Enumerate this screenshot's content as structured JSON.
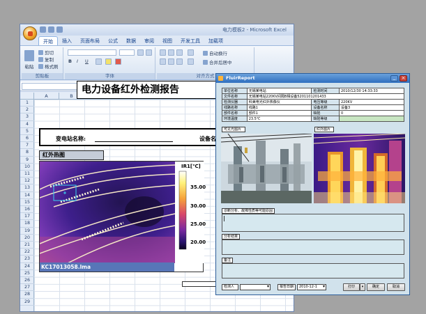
{
  "excel": {
    "window_title": "电力模板2 - Microsoft Excel",
    "tabs": [
      "开始",
      "插入",
      "页面布局",
      "公式",
      "数据",
      "审阅",
      "视图",
      "开发工具",
      "加载项"
    ],
    "ribbon": {
      "cut": "剪切",
      "copy": "复制",
      "format_painter": "格式刷",
      "paste": "粘贴",
      "clipboard_group": "剪贴板",
      "font_group": "字体",
      "align_group": "对齐方式",
      "wrap_text": "自动换行",
      "merge_center": "合并后居中",
      "bold": "B",
      "italic": "I",
      "underline": "U"
    },
    "fx": "fx",
    "columns": [
      "A",
      "B",
      "C",
      "D",
      "E",
      "F",
      "G"
    ],
    "rows": [
      "1",
      "2",
      "3",
      "4",
      "5",
      "6",
      "7",
      "8",
      "9",
      "10",
      "11",
      "12",
      "13",
      "14",
      "15",
      "16",
      "17",
      "18",
      "19",
      "20",
      "21",
      "22",
      "23",
      "24",
      "25",
      "26",
      "27",
      "28",
      "29"
    ],
    "report_title": "电力设备红外检测报告",
    "station_label": "变电站名称:",
    "device_label": "设备名称:",
    "ir_image_label": "红外热图",
    "scale_title": "IR1[℃]",
    "scale_ticks": [
      "35.00",
      "30.00",
      "25.00",
      "20.00"
    ],
    "ir_filename": "KC17013058.lma"
  },
  "dialog": {
    "title": "FluirReport",
    "info_rows": [
      [
        "单位名称",
        "无锡某电站",
        "检测时间",
        "2010/12/30 14:33:33"
      ],
      [
        "文件名称",
        "无锡某电站220KV间隔B相设备5201101201433",
        "",
        ""
      ],
      [
        "检测仪器",
        "科美电光红外热像仪",
        "电压等级",
        "220KV"
      ],
      [
        "线路名称",
        "线路1",
        "设备名称",
        "设备3"
      ],
      [
        "部件名称",
        "部件1",
        "缺陷",
        "0"
      ],
      [
        "环境温度",
        "23.5℃",
        "缺陷等级",
        ""
      ]
    ],
    "visible_photo_label": "可见光图片",
    "ir_photo_label": "红外图片",
    "analysis_label": "诊断分析、故障性质等可能原因",
    "analysis_text": "",
    "opinion_label": "分析结果",
    "opinion_text": "",
    "remark_label": "备注",
    "remark_text": "",
    "footer": {
      "inspector_label": "检测人",
      "inspector_value": "",
      "report_date_label": "报告日期",
      "report_date_value": "2010-12-1",
      "print_button": "打印",
      "save_button": "确定",
      "cancel_button": "取消"
    }
  }
}
